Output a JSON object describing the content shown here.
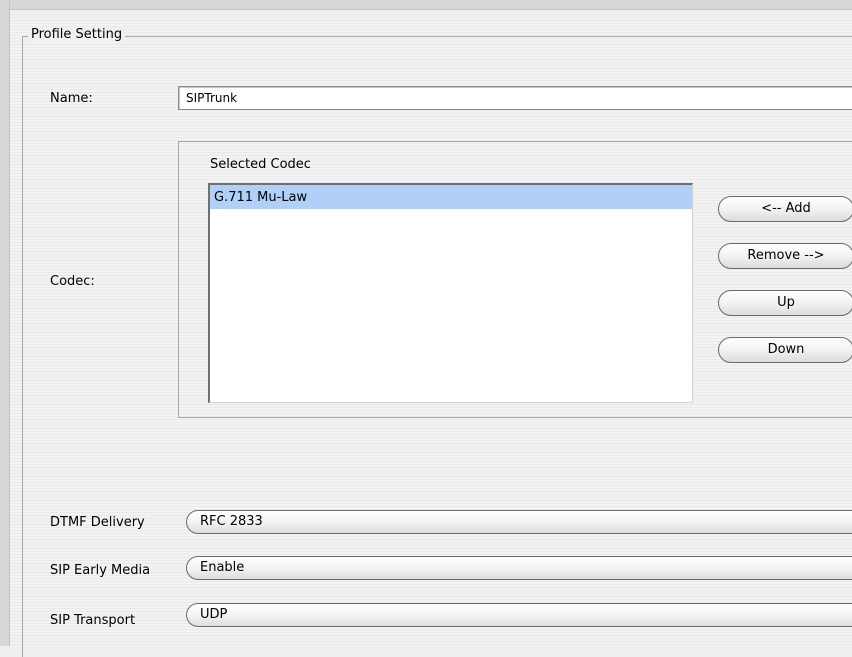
{
  "profile": {
    "legend": "Profile Setting",
    "name_label": "Name:",
    "name_value": "SIPTrunk",
    "codec_label": "Codec:"
  },
  "codec": {
    "selected_heading": "Selected Codec",
    "selected_items": [
      "G.711 Mu-Law"
    ],
    "buttons": {
      "add": "<-- Add",
      "remove": "Remove -->",
      "up": "Up",
      "down": "Down"
    }
  },
  "options": {
    "dtmf": {
      "label": "DTMF Delivery",
      "value": "RFC 2833"
    },
    "early_media": {
      "label": "SIP Early Media",
      "value": "Enable"
    },
    "transport": {
      "label": "SIP Transport",
      "value": "UDP"
    }
  },
  "colors": {
    "selection": "#b0d0f8",
    "background": "#efefef"
  }
}
